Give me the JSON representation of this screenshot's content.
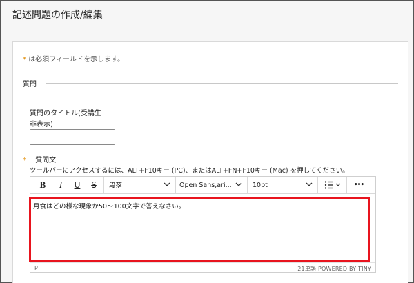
{
  "page": {
    "title": "記述問題の作成/編集"
  },
  "form": {
    "required_mark": "*",
    "required_note": "は必須フィールドを示します。",
    "section_legend": "質問",
    "title_label": "質問のタイトル(受講生\n非表示)",
    "title_value": "",
    "question_label": "質問文",
    "toolbar_hint": "ツールバーにアクセスするには、ALT+F10キー (PC)、またはALT+FN+F10キー (Mac) を押してください。"
  },
  "editor": {
    "toolbar": {
      "bold": "B",
      "italic": "I",
      "underline": "U",
      "strikethrough": "S",
      "block_format": "段落",
      "font_family": "Open Sans,ari...",
      "font_size": "10pt",
      "more": "•••"
    },
    "content": "月食はどの様な現象か50～100文字で答えなさい。",
    "status_path": "P",
    "word_count": "21単語",
    "powered_by": "POWERED BY TINY"
  },
  "colors": {
    "highlight": "#e8141e",
    "asterisk": "#e08a00"
  },
  "icons": [
    "bold-icon",
    "italic-icon",
    "underline-icon",
    "strikethrough-icon",
    "chevron-down-icon",
    "list-icon",
    "more-icon"
  ]
}
